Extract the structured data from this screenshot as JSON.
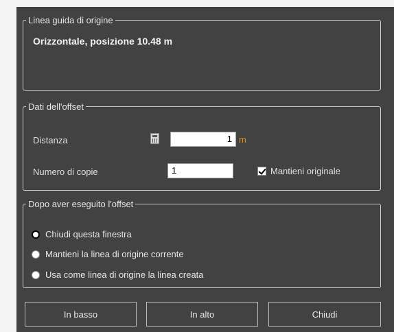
{
  "origin_group": {
    "legend": "Linea guida di origine",
    "text": "Orizzontale, posizione  10.48 m"
  },
  "offset_group": {
    "legend": "Dati dell'offset",
    "distance_label": "Distanza",
    "distance_value": "1",
    "distance_unit": "m",
    "copies_label": "Numero di copie",
    "copies_value": "1",
    "keep_original_label": "Mantieni originale",
    "keep_original_checked": true
  },
  "after_group": {
    "legend": "Dopo aver eseguito l'offset",
    "options": [
      {
        "label": "Chiudi questa finestra",
        "selected": true
      },
      {
        "label": "Mantieni la linea di origine corrente",
        "selected": false
      },
      {
        "label": "Usa come linea di origine la linea creata",
        "selected": false
      }
    ]
  },
  "buttons": {
    "down": "In basso",
    "up": "In alto",
    "close": "Chiudi"
  },
  "colors": {
    "dialog_bg": "#424242",
    "unit_accent": "#e08a1e"
  }
}
